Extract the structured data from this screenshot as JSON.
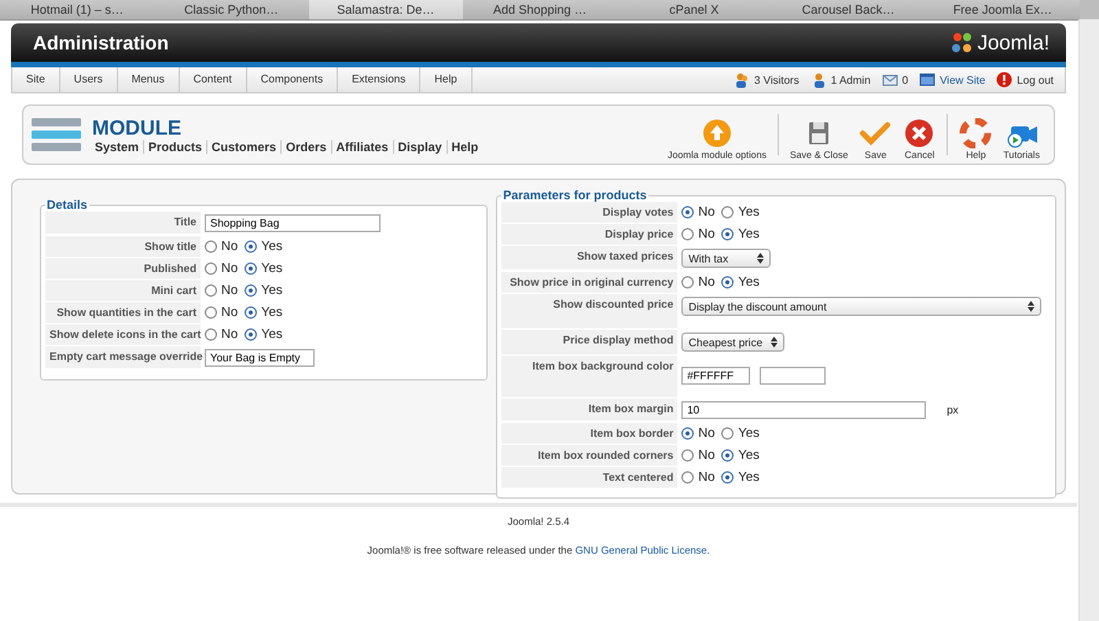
{
  "browser_tabs": [
    {
      "label": "Hotmail (1) – s…",
      "selected": false
    },
    {
      "label": "Classic Python…",
      "selected": false
    },
    {
      "label": "Salamastra: De…",
      "selected": true
    },
    {
      "label": "Add Shopping …",
      "selected": false
    },
    {
      "label": "cPanel X",
      "selected": false
    },
    {
      "label": "Carousel Back…",
      "selected": false
    },
    {
      "label": "Free Joomla Ex…",
      "selected": false
    }
  ],
  "header": {
    "title": "Administration",
    "logo": "Joomla!"
  },
  "menu": {
    "items": [
      "Site",
      "Users",
      "Menus",
      "Content",
      "Components",
      "Extensions",
      "Help"
    ],
    "status": [
      {
        "kind": "visitors",
        "text": "3 Visitors"
      },
      {
        "kind": "admin",
        "text": "1 Admin"
      },
      {
        "kind": "messages",
        "text": "0"
      },
      {
        "kind": "site",
        "text": "View Site"
      },
      {
        "kind": "logout",
        "text": "Log out"
      }
    ]
  },
  "toolbar": {
    "title": "MODULE",
    "submenu": [
      "System",
      "Products",
      "Customers",
      "Orders",
      "Affiliates",
      "Display",
      "Help"
    ],
    "buttons": [
      {
        "kind": "options",
        "label": "Joomla module options"
      },
      {
        "kind": "save-close",
        "label": "Save & Close"
      },
      {
        "kind": "save",
        "label": "Save"
      },
      {
        "kind": "cancel",
        "label": "Cancel"
      },
      {
        "kind": "help",
        "label": "Help"
      },
      {
        "kind": "tutorials",
        "label": "Tutorials"
      }
    ]
  },
  "details": {
    "legend": "Details",
    "fields": [
      {
        "kind": "text",
        "label": "Title",
        "value": "Shopping Bag"
      },
      {
        "kind": "radio",
        "label": "Show title",
        "options": [
          {
            "label": "No",
            "selected": false
          },
          {
            "label": "Yes",
            "selected": true
          }
        ]
      },
      {
        "kind": "radio",
        "label": "Published",
        "options": [
          {
            "label": "No",
            "selected": false
          },
          {
            "label": "Yes",
            "selected": true
          }
        ]
      },
      {
        "kind": "radio",
        "label": "Mini cart",
        "options": [
          {
            "label": "No",
            "selected": false
          },
          {
            "label": "Yes",
            "selected": true
          }
        ]
      },
      {
        "kind": "radio",
        "label": "Show quantities in the cart",
        "options": [
          {
            "label": "No",
            "selected": false
          },
          {
            "label": "Yes",
            "selected": true
          }
        ]
      },
      {
        "kind": "radio",
        "label": "Show delete icons in the cart",
        "options": [
          {
            "label": "No",
            "selected": false
          },
          {
            "label": "Yes",
            "selected": true
          }
        ]
      },
      {
        "kind": "text",
        "label": "Empty cart message override",
        "value": "Your Bag is Empty"
      }
    ]
  },
  "parameters": {
    "legend": "Parameters for products",
    "fields": [
      {
        "kind": "radio",
        "label": "Display votes",
        "options": [
          {
            "label": "No",
            "selected": true
          },
          {
            "label": "Yes",
            "selected": false
          }
        ]
      },
      {
        "kind": "radio",
        "label": "Display price",
        "options": [
          {
            "label": "No",
            "selected": false
          },
          {
            "label": "Yes",
            "selected": true
          }
        ]
      },
      {
        "kind": "select",
        "label": "Show taxed prices",
        "value": "With tax"
      },
      {
        "kind": "radio",
        "label": "Show price in original currency",
        "options": [
          {
            "label": "No",
            "selected": false
          },
          {
            "label": "Yes",
            "selected": true
          }
        ]
      },
      {
        "kind": "select",
        "label": "Show discounted price",
        "value": "Display the discount amount"
      },
      {
        "kind": "select",
        "label": "Price display method",
        "value": "Cheapest price"
      },
      {
        "kind": "color",
        "label": "Item box background color",
        "value": "#FFFFFF"
      },
      {
        "kind": "text",
        "label": "Item box margin",
        "value": "10",
        "unit": "px"
      },
      {
        "kind": "radio",
        "label": "Item box border",
        "options": [
          {
            "label": "No",
            "selected": true
          },
          {
            "label": "Yes",
            "selected": false
          }
        ]
      },
      {
        "kind": "radio",
        "label": "Item box rounded corners",
        "options": [
          {
            "label": "No",
            "selected": false
          },
          {
            "label": "Yes",
            "selected": true
          }
        ]
      },
      {
        "kind": "radio",
        "label": "Text centered",
        "options": [
          {
            "label": "No",
            "selected": false
          },
          {
            "label": "Yes",
            "selected": true
          }
        ]
      }
    ]
  },
  "footer": {
    "version": "Joomla! 2.5.4",
    "license": {
      "before": "Joomla!® is free software released under the ",
      "link": "GNU General Public License",
      "after": "."
    }
  }
}
